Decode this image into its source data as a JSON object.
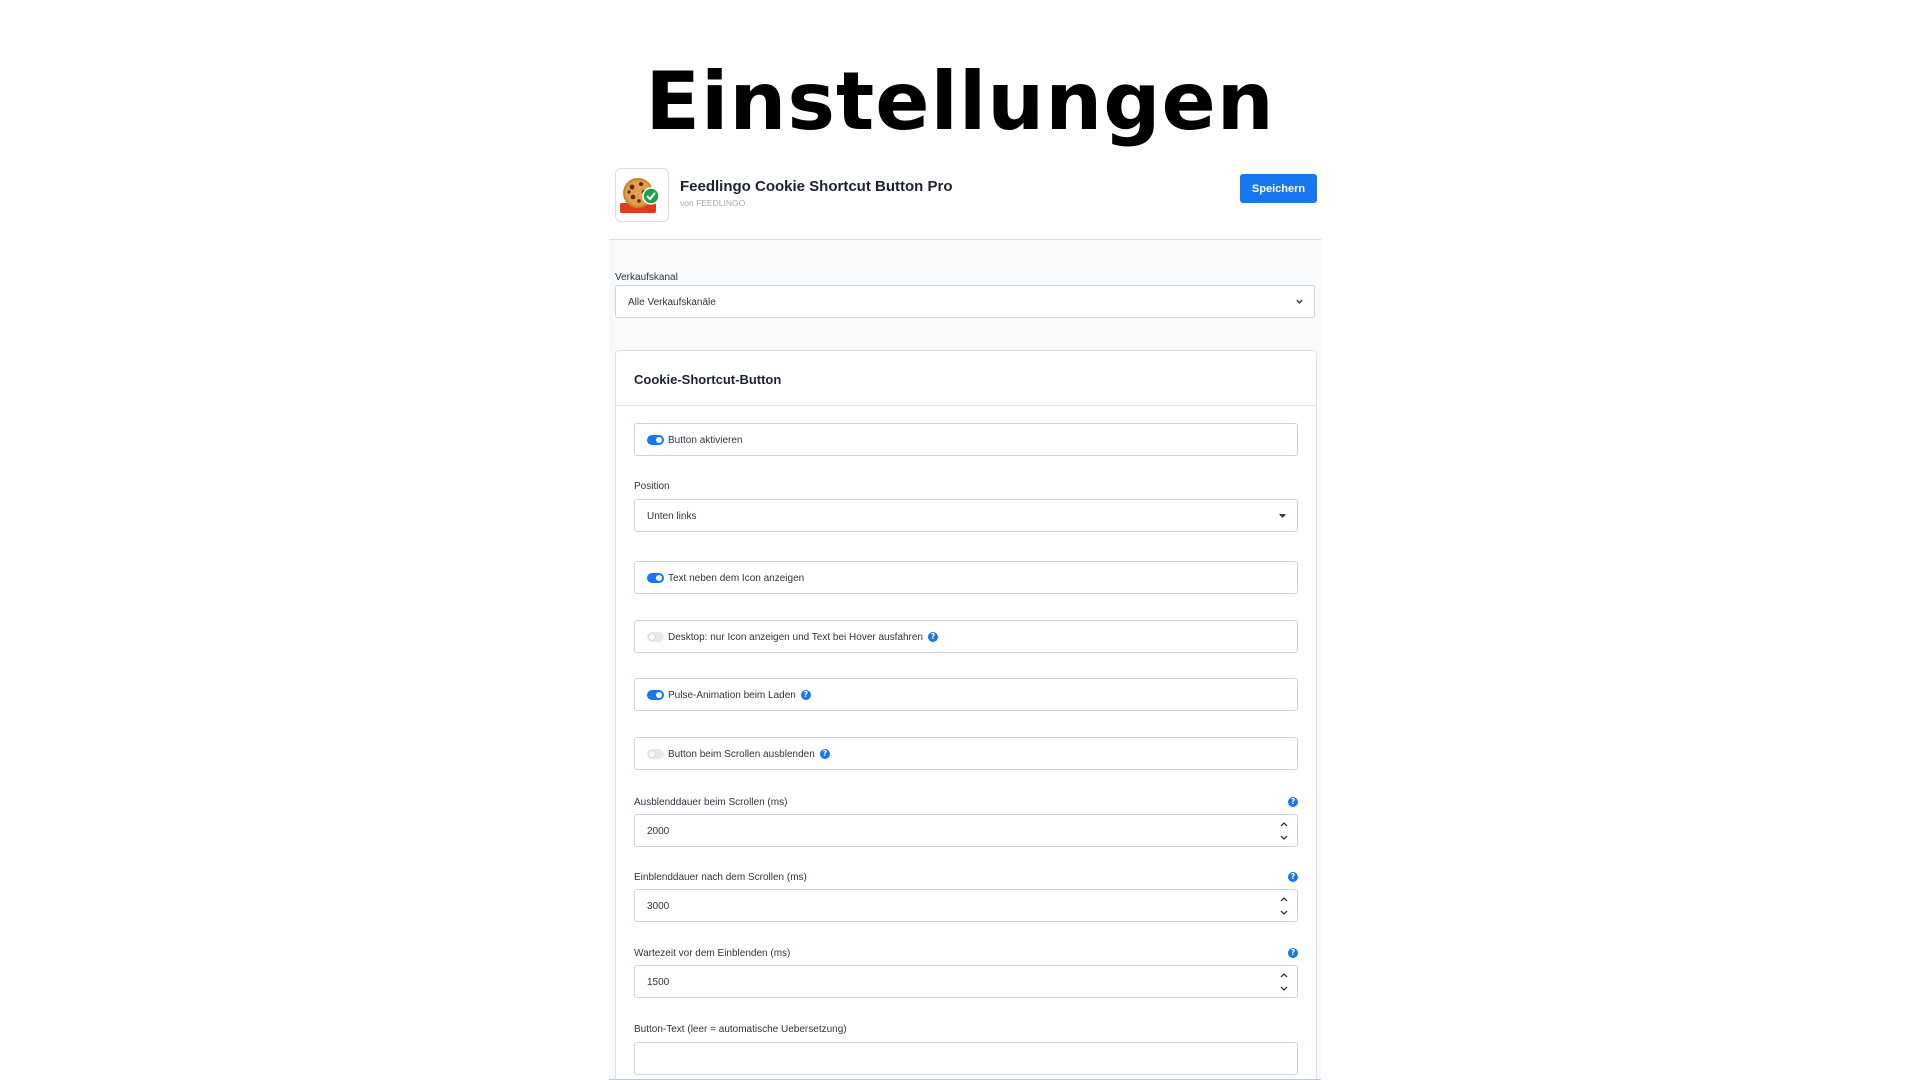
{
  "page_heading": "Einstellungen",
  "app": {
    "title": "Feedlingo Cookie Shortcut Button Pro",
    "vendor": "von FEEDLINGO",
    "save_label": "Speichern",
    "logo_icon": "cookie-check-icon"
  },
  "sales_channel": {
    "label": "Verkaufskanal",
    "value": "Alle Verkaufskanäle"
  },
  "card": {
    "title": "Cookie-Shortcut-Button",
    "toggles": [
      {
        "label": "Button aktivieren",
        "enabled": true,
        "help": false
      },
      {
        "label": "Text neben dem Icon anzeigen",
        "enabled": true,
        "help": false
      },
      {
        "label": "Desktop: nur Icon anzeigen und Text bei Hover ausfahren",
        "enabled": false,
        "help": true
      },
      {
        "label": "Pulse-Animation beim Laden",
        "enabled": true,
        "help": true
      },
      {
        "label": "Button beim Scrollen ausblenden",
        "enabled": false,
        "help": true
      }
    ],
    "position": {
      "label": "Position",
      "value": "Unten links"
    },
    "numbers": [
      {
        "label": "Ausblenddauer beim Scrollen (ms)",
        "value": "2000"
      },
      {
        "label": "Einblenddauer nach dem Scrollen (ms)",
        "value": "3000"
      },
      {
        "label": "Wartezeit vor dem Einblenden (ms)",
        "value": "1500"
      }
    ],
    "button_text": {
      "label": "Button-Text (leer = automatische Uebersetzung)",
      "value": ""
    }
  },
  "colors": {
    "accent": "#1677ee",
    "border": "#cdd3db",
    "background": "#f8f9fb"
  },
  "help_glyph": "?"
}
